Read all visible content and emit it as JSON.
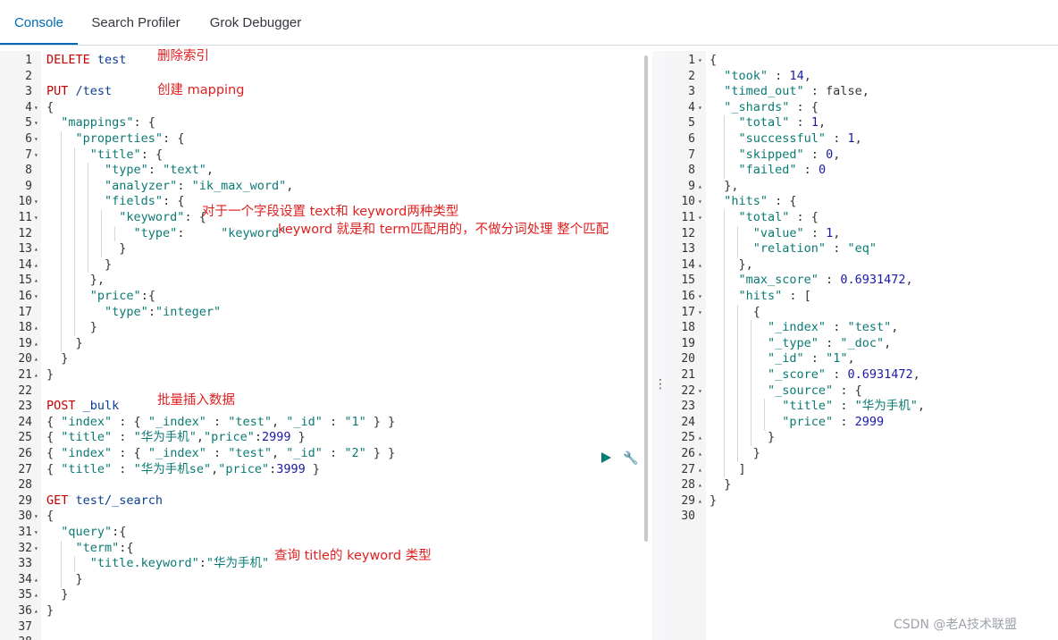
{
  "tabs": [
    {
      "label": "Console",
      "active": true
    },
    {
      "label": "Search Profiler",
      "active": false
    },
    {
      "label": "Grok Debugger",
      "active": false
    }
  ],
  "request_lines": [
    {
      "n": "1",
      "fold": "",
      "text": "DELETE test"
    },
    {
      "n": "2",
      "fold": "",
      "text": ""
    },
    {
      "n": "3",
      "fold": "",
      "text": "PUT /test"
    },
    {
      "n": "4",
      "fold": "▾",
      "text": "{"
    },
    {
      "n": "5",
      "fold": "▾",
      "text": "  \"mappings\": {"
    },
    {
      "n": "6",
      "fold": "▾",
      "text": "    \"properties\": {"
    },
    {
      "n": "7",
      "fold": "▾",
      "text": "      \"title\": {"
    },
    {
      "n": "8",
      "fold": "",
      "text": "        \"type\": \"text\","
    },
    {
      "n": "9",
      "fold": "",
      "text": "        \"analyzer\": \"ik_max_word\","
    },
    {
      "n": "10",
      "fold": "▾",
      "text": "        \"fields\": {"
    },
    {
      "n": "11",
      "fold": "▾",
      "text": "          \"keyword\": {"
    },
    {
      "n": "12",
      "fold": "",
      "text": "            \"type\":     \"keyword\""
    },
    {
      "n": "13",
      "fold": "▴",
      "text": "          }"
    },
    {
      "n": "14",
      "fold": "▴",
      "text": "        }"
    },
    {
      "n": "15",
      "fold": "▴",
      "text": "      },"
    },
    {
      "n": "16",
      "fold": "▾",
      "text": "      \"price\":{"
    },
    {
      "n": "17",
      "fold": "",
      "text": "        \"type\":\"integer\""
    },
    {
      "n": "18",
      "fold": "▴",
      "text": "      }"
    },
    {
      "n": "19",
      "fold": "▴",
      "text": "    }"
    },
    {
      "n": "20",
      "fold": "▴",
      "text": "  }"
    },
    {
      "n": "21",
      "fold": "▴",
      "text": "}"
    },
    {
      "n": "22",
      "fold": "",
      "text": ""
    },
    {
      "n": "23",
      "fold": "",
      "text": "POST _bulk"
    },
    {
      "n": "24",
      "fold": "",
      "text": "{ \"index\" : { \"_index\" : \"test\", \"_id\" : \"1\" } }"
    },
    {
      "n": "25",
      "fold": "",
      "text": "{ \"title\" : \"华为手机\",\"price\":2999 }"
    },
    {
      "n": "26",
      "fold": "",
      "text": "{ \"index\" : { \"_index\" : \"test\", \"_id\" : \"2\" } }"
    },
    {
      "n": "27",
      "fold": "",
      "text": "{ \"title\" : \"华为手机se\",\"price\":3999 }"
    },
    {
      "n": "28",
      "fold": "",
      "text": ""
    },
    {
      "n": "29",
      "fold": "",
      "text": "GET test/_search"
    },
    {
      "n": "30",
      "fold": "▾",
      "text": "{"
    },
    {
      "n": "31",
      "fold": "▾",
      "text": "  \"query\":{"
    },
    {
      "n": "32",
      "fold": "▾",
      "text": "    \"term\":{"
    },
    {
      "n": "33",
      "fold": "",
      "text": "      \"title.keyword\":\"华为手机\""
    },
    {
      "n": "34",
      "fold": "▴",
      "text": "    }"
    },
    {
      "n": "35",
      "fold": "▴",
      "text": "  }"
    },
    {
      "n": "36",
      "fold": "▴",
      "text": "}"
    },
    {
      "n": "37",
      "fold": "",
      "text": ""
    },
    {
      "n": "38",
      "fold": "",
      "text": ""
    }
  ],
  "annotations": {
    "delete": "删除索引",
    "create": "创建 mapping",
    "keyword_note": "对于一个字段设置 text和 keyword两种类型",
    "keyword_desc": "keyword 就是和 term匹配用的，不做分词处理 整个匹配",
    "bulk": "批量插入数据",
    "query": "查询 title的 keyword 类型"
  },
  "response_lines": [
    {
      "n": "1",
      "fold": "▾",
      "text": "{"
    },
    {
      "n": "2",
      "fold": "",
      "text": "  \"took\" : 14,"
    },
    {
      "n": "3",
      "fold": "",
      "text": "  \"timed_out\" : false,"
    },
    {
      "n": "4",
      "fold": "▾",
      "text": "  \"_shards\" : {"
    },
    {
      "n": "5",
      "fold": "",
      "text": "    \"total\" : 1,"
    },
    {
      "n": "6",
      "fold": "",
      "text": "    \"successful\" : 1,"
    },
    {
      "n": "7",
      "fold": "",
      "text": "    \"skipped\" : 0,"
    },
    {
      "n": "8",
      "fold": "",
      "text": "    \"failed\" : 0"
    },
    {
      "n": "9",
      "fold": "▴",
      "text": "  },"
    },
    {
      "n": "10",
      "fold": "▾",
      "text": "  \"hits\" : {"
    },
    {
      "n": "11",
      "fold": "▾",
      "text": "    \"total\" : {"
    },
    {
      "n": "12",
      "fold": "",
      "text": "      \"value\" : 1,"
    },
    {
      "n": "13",
      "fold": "",
      "text": "      \"relation\" : \"eq\""
    },
    {
      "n": "14",
      "fold": "▴",
      "text": "    },"
    },
    {
      "n": "15",
      "fold": "",
      "text": "    \"max_score\" : 0.6931472,"
    },
    {
      "n": "16",
      "fold": "▾",
      "text": "    \"hits\" : ["
    },
    {
      "n": "17",
      "fold": "▾",
      "text": "      {"
    },
    {
      "n": "18",
      "fold": "",
      "text": "        \"_index\" : \"test\","
    },
    {
      "n": "19",
      "fold": "",
      "text": "        \"_type\" : \"_doc\","
    },
    {
      "n": "20",
      "fold": "",
      "text": "        \"_id\" : \"1\","
    },
    {
      "n": "21",
      "fold": "",
      "text": "        \"_score\" : 0.6931472,"
    },
    {
      "n": "22",
      "fold": "▾",
      "text": "        \"_source\" : {"
    },
    {
      "n": "23",
      "fold": "",
      "text": "          \"title\" : \"华为手机\","
    },
    {
      "n": "24",
      "fold": "",
      "text": "          \"price\" : 2999"
    },
    {
      "n": "25",
      "fold": "▴",
      "text": "        }"
    },
    {
      "n": "26",
      "fold": "▴",
      "text": "      }"
    },
    {
      "n": "27",
      "fold": "▴",
      "text": "    ]"
    },
    {
      "n": "28",
      "fold": "▴",
      "text": "  }"
    },
    {
      "n": "29",
      "fold": "▴",
      "text": "}"
    },
    {
      "n": "30",
      "fold": "",
      "text": ""
    }
  ],
  "divider_icon": "drag-handle-icon",
  "run_icon": "play-icon",
  "wrench_icon": "wrench-icon",
  "watermark": "CSDN @老A技术联盟",
  "colors": {
    "accent": "#006bb4",
    "annotation": "#e02020",
    "method": "#c80000",
    "string": "#0b7a75"
  }
}
